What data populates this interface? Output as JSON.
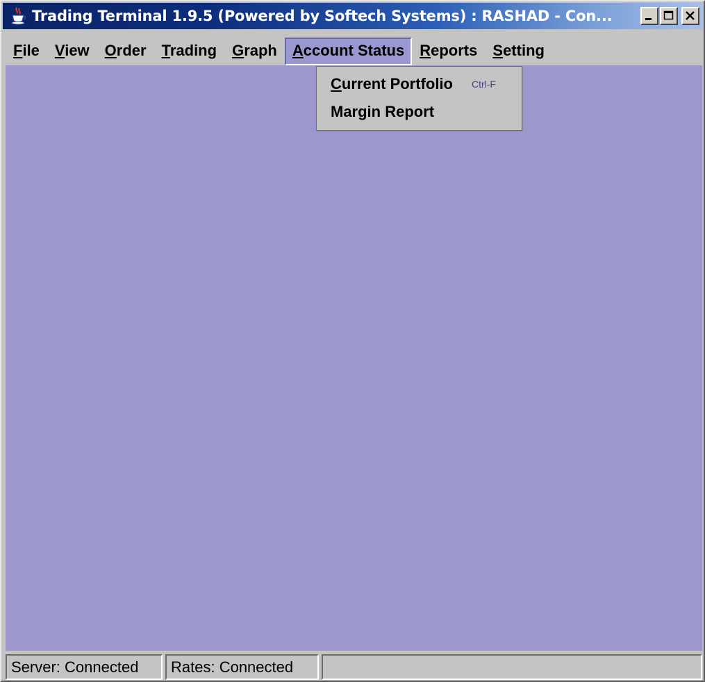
{
  "window": {
    "title": "Trading Terminal 1.9.5 (Powered by Softech Systems)   :   RASHAD - Con...",
    "controls": [
      "minimize-icon",
      "maximize-icon",
      "close-icon"
    ]
  },
  "menubar": {
    "items": [
      {
        "mnemonic": "F",
        "rest": "ile"
      },
      {
        "mnemonic": "V",
        "rest": "iew"
      },
      {
        "mnemonic": "O",
        "rest": "rder"
      },
      {
        "mnemonic": "T",
        "rest": "rading"
      },
      {
        "mnemonic": "G",
        "rest": "raph"
      },
      {
        "mnemonic": "A",
        "rest": "ccount Status"
      },
      {
        "mnemonic": "R",
        "rest": "eports"
      },
      {
        "mnemonic": "S",
        "rest": "etting"
      }
    ],
    "active_index": 5
  },
  "dropdown": {
    "items": [
      {
        "mnemonic": "C",
        "rest": "urrent Portfolio",
        "shortcut": "Ctrl-F"
      },
      {
        "label": "Margin Report"
      }
    ]
  },
  "statusbar": {
    "server": "Server: Connected",
    "rates": "Rates: Connected",
    "extra": ""
  },
  "colors": {
    "desktop": "#9c98ce",
    "title_gradient_start": "#0b2466",
    "title_gradient_end": "#a6c0ea",
    "menu_active": "#9a99cf",
    "shortcut_text": "#44448c"
  }
}
